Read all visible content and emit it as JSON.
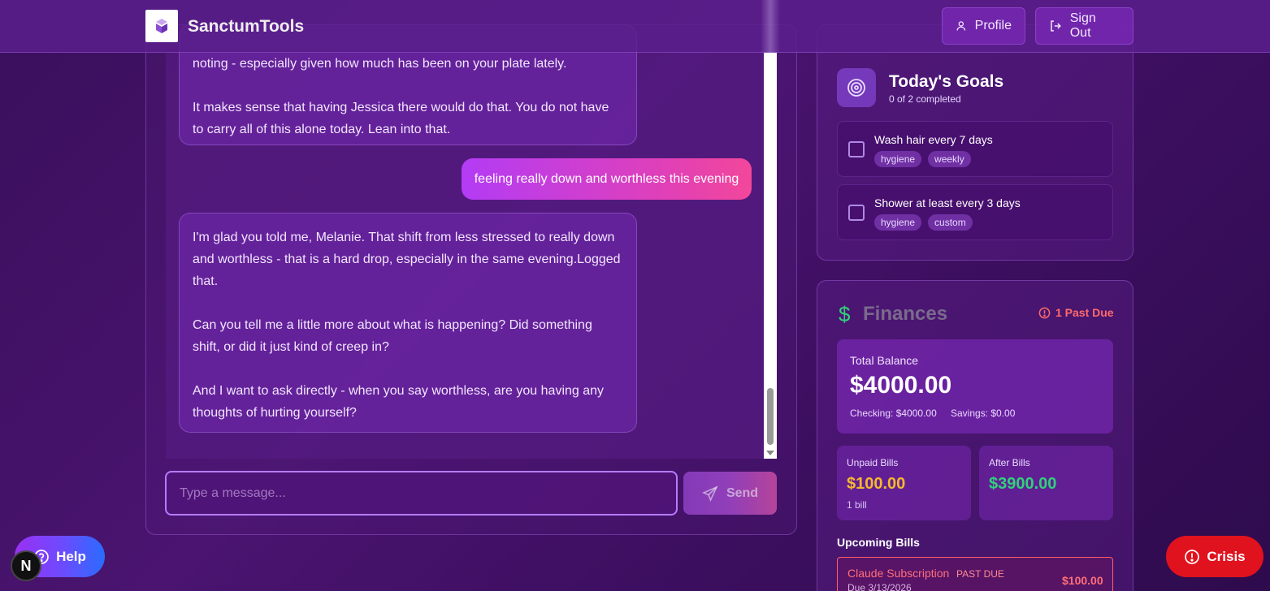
{
  "header": {
    "brand": "SanctumTools",
    "profile_label": "Profile",
    "signout_label": "Sign Out"
  },
  "chat": {
    "messages": {
      "ai_1": {
        "p1": "noting - especially given how much has been on your plate lately.",
        "p2": "It makes sense that having Jessica there would do that. You do not have to carry all of this alone today. Lean into that."
      },
      "user_1": "feeling really down and worthless this evening",
      "ai_2": {
        "p1": "I'm glad you told me, Melanie. That shift from less stressed to really down and worthless - that is a hard drop, especially in the same evening.Logged that.",
        "p2": "Can you tell me a little more about what is happening? Did something shift, or did it just kind of creep in?",
        "p3": "And I want to ask directly - when you say worthless, are you having any thoughts of hurting yourself?"
      }
    },
    "input_placeholder": "Type a message...",
    "input_value": "",
    "send_label": "Send"
  },
  "goals": {
    "title": "Today's Goals",
    "subtitle": "0 of 2 completed",
    "items": [
      {
        "title": "Wash hair every 7 days",
        "tags": [
          "hygiene",
          "weekly"
        ],
        "checked": false
      },
      {
        "title": "Shower at least every 3 days",
        "tags": [
          "hygiene",
          "custom"
        ],
        "checked": false
      }
    ]
  },
  "finances": {
    "title": "Finances",
    "past_due_badge": "1 Past Due",
    "total_balance_label": "Total Balance",
    "total_balance": "$4000.00",
    "checking": "Checking: $4000.00",
    "savings": "Savings: $0.00",
    "unpaid_label": "Unpaid Bills",
    "unpaid_value": "$100.00",
    "unpaid_sub": "1 bill",
    "after_label": "After Bills",
    "after_value": "$3900.00",
    "upcoming_title": "Upcoming Bills",
    "bills": [
      {
        "name": "Claude Subscription",
        "status": "PAST DUE",
        "due": "Due 3/13/2026",
        "amount": "$100.00"
      }
    ]
  },
  "floating": {
    "help_label": "Help",
    "crisis_label": "Crisis",
    "next_badge": "N"
  },
  "colors": {
    "accent_purple": "#b57cff",
    "user_bubble_start": "#b33cf5",
    "user_bubble_end": "#f2479a",
    "money_green": "#2fd27a",
    "warn_yellow": "#f5b82e",
    "danger_red": "#ff5f6d",
    "crisis_red": "#e0121e"
  }
}
